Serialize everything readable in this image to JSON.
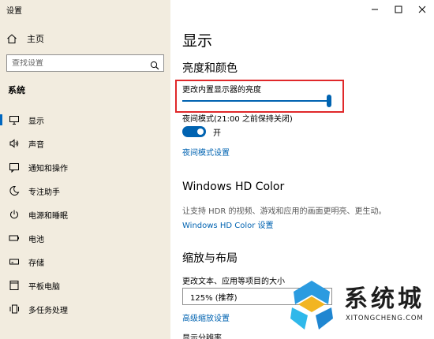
{
  "window": {
    "title": "设置"
  },
  "sidebar": {
    "home_label": "主页",
    "search_placeholder": "查找设置",
    "section": "系统",
    "items": [
      {
        "label": "显示",
        "icon": "monitor-icon",
        "selected": true
      },
      {
        "label": "声音",
        "icon": "speaker-icon"
      },
      {
        "label": "通知和操作",
        "icon": "notification-icon"
      },
      {
        "label": "专注助手",
        "icon": "moon-icon"
      },
      {
        "label": "电源和睡眠",
        "icon": "power-icon"
      },
      {
        "label": "电池",
        "icon": "battery-icon"
      },
      {
        "label": "存储",
        "icon": "storage-icon"
      },
      {
        "label": "平板电脑",
        "icon": "tablet-icon"
      },
      {
        "label": "多任务处理",
        "icon": "multitask-icon"
      }
    ]
  },
  "main": {
    "title": "显示",
    "brightness_section": "亮度和颜色",
    "brightness_label": "更改内置显示器的亮度",
    "brightness_level_percent": 100,
    "night_light_label": "夜间模式(21:00 之前保持关闭)",
    "night_light_toggle": "开",
    "night_light_link": "夜间模式设置",
    "hdr_section": "Windows HD Color",
    "hdr_desc": "让支持 HDR 的视频、游戏和应用的画面更明亮、更生动。",
    "hdr_link": "Windows HD Color 设置",
    "scale_section": "缩放与布局",
    "scale_label": "更改文本、应用等项目的大小",
    "scale_value": "125% (推荐)",
    "scale_link": "高级缩放设置",
    "resolution_label": "显示分辨率"
  },
  "watermark": {
    "text": "系统城",
    "sub": "XITONGCHENG.COM"
  },
  "colors": {
    "accent": "#0063b1",
    "sidebar_bg": "#f2ecdf",
    "highlight": "#e0282a"
  }
}
